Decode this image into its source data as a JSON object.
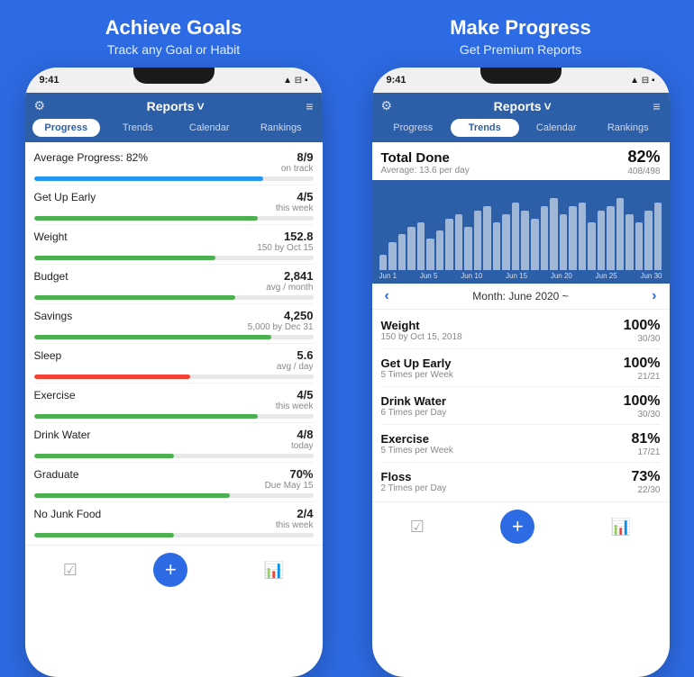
{
  "left": {
    "title": "Achieve Goals",
    "subtitle": "Track any Goal or Habit",
    "status_time": "9:41",
    "status_icons": "▲ ⊟",
    "header_title": "Reports",
    "header_chevron": "˅",
    "tabs": [
      "Progress",
      "Trends",
      "Calendar",
      "Rankings"
    ],
    "active_tab": "Progress",
    "items": [
      {
        "label": "Average Progress: 82%",
        "value": "8/9",
        "sub": "on track",
        "pct": 82,
        "color": "blue"
      },
      {
        "label": "Get Up Early",
        "value": "4/5",
        "sub": "this week",
        "pct": 80,
        "color": "green"
      },
      {
        "label": "Weight",
        "value": "152.8",
        "sub": "150 by Oct 15",
        "pct": 65,
        "color": "green"
      },
      {
        "label": "Budget",
        "value": "2,841",
        "sub": "avg / month",
        "pct": 72,
        "color": "green"
      },
      {
        "label": "Savings",
        "value": "4,250",
        "sub": "5,000 by Dec 31",
        "pct": 85,
        "color": "green"
      },
      {
        "label": "Sleep",
        "value": "5.6",
        "sub": "avg / day",
        "pct": 56,
        "color": "red"
      },
      {
        "label": "Exercise",
        "value": "4/5",
        "sub": "this week",
        "pct": 80,
        "color": "green"
      },
      {
        "label": "Drink Water",
        "value": "4/8",
        "sub": "today",
        "pct": 50,
        "color": "green"
      },
      {
        "label": "Graduate",
        "value": "70%",
        "sub": "Due May 15",
        "pct": 70,
        "color": "green"
      },
      {
        "label": "No Junk Food",
        "value": "2/4",
        "sub": "this week",
        "pct": 50,
        "color": "green"
      }
    ],
    "nav": {
      "check_icon": "☑",
      "add_icon": "+",
      "chart_icon": "📊"
    }
  },
  "right": {
    "title": "Make Progress",
    "subtitle": "Get Premium Reports",
    "status_time": "9:41",
    "header_title": "Reports",
    "active_tab": "Trends",
    "tabs": [
      "Progress",
      "Trends",
      "Calendar",
      "Rankings"
    ],
    "total_done_label": "Total Done",
    "total_done_sub": "Average: 13.6 per day",
    "total_pct": "82%",
    "total_count": "408/498",
    "chart_bars": [
      20,
      35,
      45,
      55,
      60,
      40,
      50,
      65,
      70,
      55,
      75,
      80,
      60,
      70,
      85,
      75,
      65,
      80,
      90,
      70,
      80,
      85,
      60,
      75,
      80,
      90,
      70,
      60,
      75,
      85
    ],
    "chart_labels": [
      "Jun 1",
      "Jun 5",
      "Jun 10",
      "Jun 15",
      "Jun 20",
      "Jun 25",
      "Jun 30"
    ],
    "month_label": "Month: June 2020 ~",
    "items": [
      {
        "label": "Weight",
        "sub": "150 by Oct 15, 2018",
        "pct": "100%",
        "count": "30/30"
      },
      {
        "label": "Get Up Early",
        "sub": "5 Times per Week",
        "pct": "100%",
        "count": "21/21"
      },
      {
        "label": "Drink Water",
        "sub": "6 Times per Day",
        "pct": "100%",
        "count": "30/30"
      },
      {
        "label": "Exercise",
        "sub": "5 Times per Week",
        "pct": "81%",
        "count": "17/21"
      },
      {
        "label": "Floss",
        "sub": "2 Times per Day",
        "pct": "73%",
        "count": "22/30"
      }
    ]
  }
}
